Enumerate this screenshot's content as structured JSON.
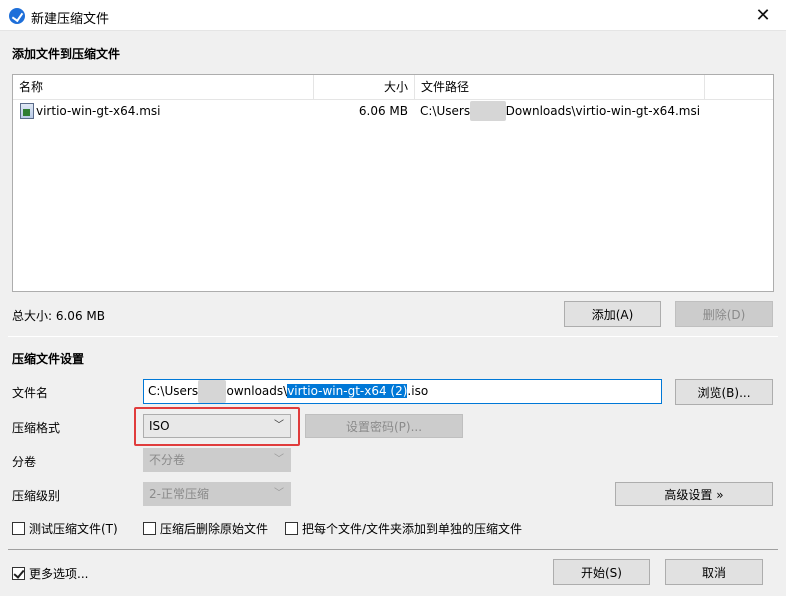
{
  "window": {
    "title": "新建压缩文件",
    "close": "✕"
  },
  "add_section": {
    "title": "添加文件到压缩文件"
  },
  "file_list": {
    "columns": [
      "名称",
      "大小",
      "文件路径"
    ],
    "rows": [
      {
        "name": "virtio-win-gt-x64.msi",
        "size": "6.06 MB",
        "path_prefix": "C:\\Users",
        "path_hidden": "xxxxx",
        "path_suffix": "Downloads\\virtio-win-gt-x64.msi"
      }
    ]
  },
  "total_size": "总大小: 6.06 MB",
  "buttons": {
    "add": "添加(A)",
    "delete": "删除(D)",
    "browse": "浏览(B)...",
    "password": "设置密码(P)...",
    "advanced": "高级设置 »",
    "start": "开始(S)",
    "cancel": "取消"
  },
  "settings_section": {
    "title": "压缩文件设置"
  },
  "labels": {
    "filename": "文件名",
    "format": "压缩格式",
    "volume": "分卷",
    "level": "压缩级别"
  },
  "filename": {
    "prefix": "C:\\Users",
    "hidden": "xxxx",
    "mid": "ownloads\\",
    "selected": "virtio-win-gt-x64 (2)",
    "ext": ".iso"
  },
  "format_value": "ISO",
  "volume_value": "不分卷",
  "level_value": "2-正常压缩",
  "options": {
    "test": "测试压缩文件(T)",
    "delete_after": "压缩后删除原始文件",
    "each_separate": "把每个文件/文件夹添加到单独的压缩文件",
    "more": "更多选项..."
  },
  "icons": [
    "app-logo-icon",
    "close-icon",
    "msi-file-icon",
    "chevron-down-icon",
    "checkbox-icon"
  ],
  "colors": {
    "accent": "#0078d7",
    "highlight": "#e03c3c"
  }
}
